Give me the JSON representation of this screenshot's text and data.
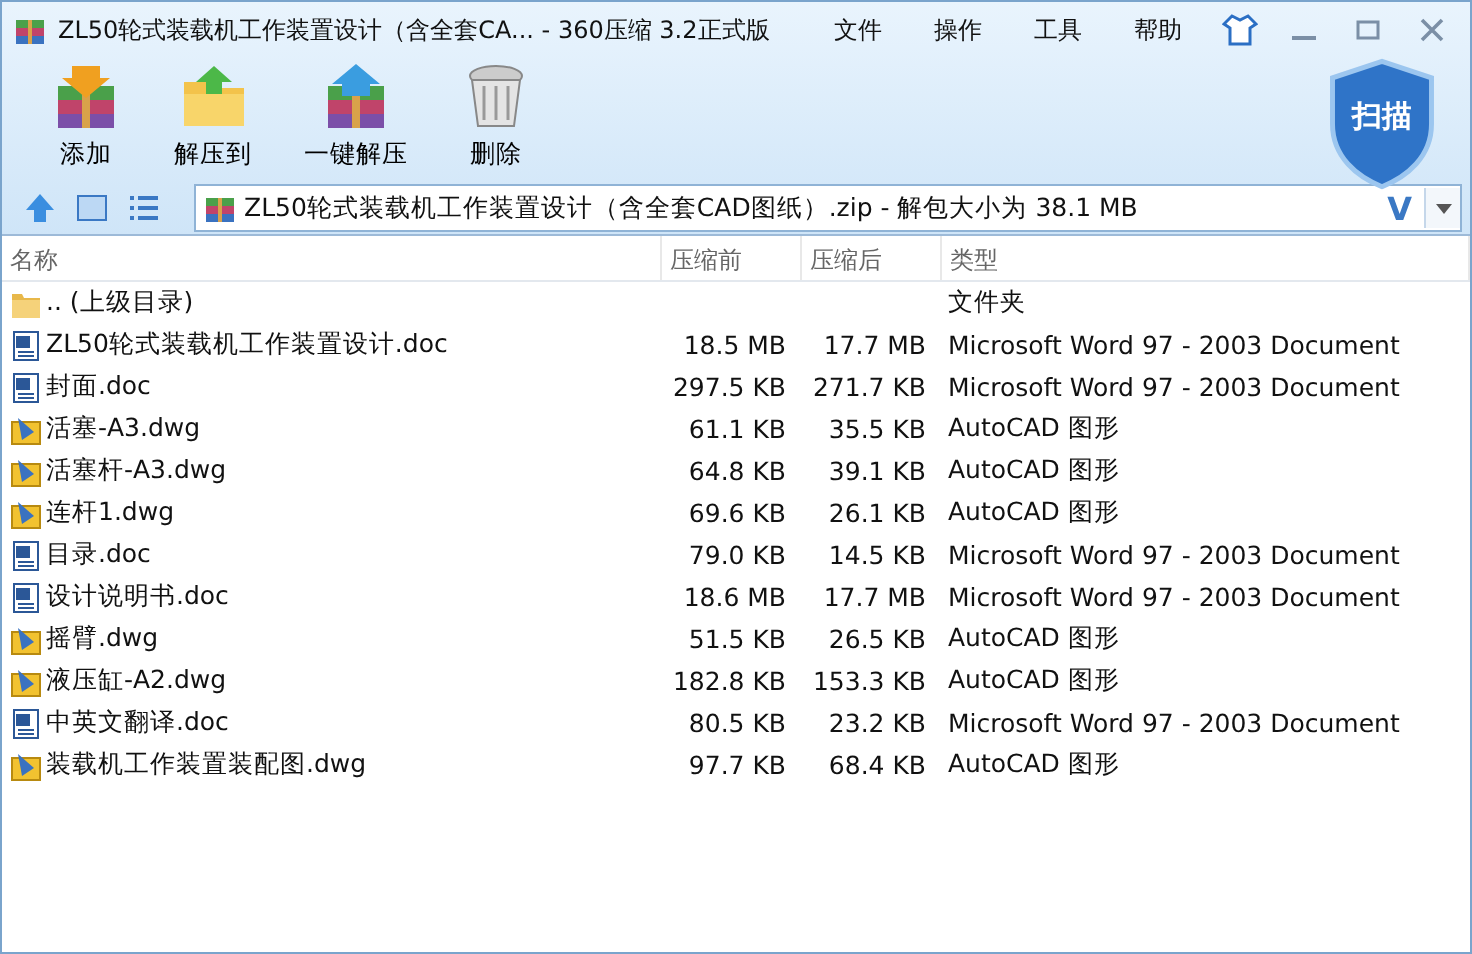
{
  "window": {
    "title": "ZL50轮式装载机工作装置设计（含全套CA... - 360压缩 3.2正式版"
  },
  "menu": [
    "文件",
    "操作",
    "工具",
    "帮助"
  ],
  "toolbar": [
    {
      "label": "添加",
      "kind": "add"
    },
    {
      "label": "解压到",
      "kind": "extract"
    },
    {
      "label": "一键解压",
      "kind": "oneclick"
    },
    {
      "label": "删除",
      "kind": "delete"
    }
  ],
  "scan_button": {
    "label": "扫描"
  },
  "address": {
    "value": "ZL50轮式装载机工作装置设计（含全套CAD图纸）.zip - 解包大小为 38.1 MB",
    "dropdown_letter": "V"
  },
  "table": {
    "columns": [
      "名称",
      "压缩前",
      "压缩后",
      "类型"
    ],
    "rows": [
      {
        "kind": "folder",
        "name": ".. (上级目录)",
        "before": "",
        "after": "",
        "type": "文件夹"
      },
      {
        "kind": "doc",
        "name": "ZL50轮式装载机工作装置设计.doc",
        "before": "18.5 MB",
        "after": "17.7 MB",
        "type": "Microsoft Word 97 - 2003 Document"
      },
      {
        "kind": "doc",
        "name": "封面.doc",
        "before": "297.5 KB",
        "after": "271.7 KB",
        "type": "Microsoft Word 97 - 2003 Document"
      },
      {
        "kind": "dwg",
        "name": "活塞-A3.dwg",
        "before": "61.1 KB",
        "after": "35.5 KB",
        "type": "AutoCAD 图形"
      },
      {
        "kind": "dwg",
        "name": "活塞杆-A3.dwg",
        "before": "64.8 KB",
        "after": "39.1 KB",
        "type": "AutoCAD 图形"
      },
      {
        "kind": "dwg",
        "name": "连杆1.dwg",
        "before": "69.6 KB",
        "after": "26.1 KB",
        "type": "AutoCAD 图形"
      },
      {
        "kind": "doc",
        "name": "目录.doc",
        "before": "79.0 KB",
        "after": "14.5 KB",
        "type": "Microsoft Word 97 - 2003 Document"
      },
      {
        "kind": "doc",
        "name": "设计说明书.doc",
        "before": "18.6 MB",
        "after": "17.7 MB",
        "type": "Microsoft Word 97 - 2003 Document"
      },
      {
        "kind": "dwg",
        "name": "摇臂.dwg",
        "before": "51.5 KB",
        "after": "26.5 KB",
        "type": "AutoCAD 图形"
      },
      {
        "kind": "dwg",
        "name": "液压缸-A2.dwg",
        "before": "182.8 KB",
        "after": "153.3 KB",
        "type": "AutoCAD 图形"
      },
      {
        "kind": "doc",
        "name": "中英文翻译.doc",
        "before": "80.5 KB",
        "after": "23.2 KB",
        "type": "Microsoft Word 97 - 2003 Document"
      },
      {
        "kind": "dwg",
        "name": "装载机工作装置装配图.dwg",
        "before": "97.7 KB",
        "after": "68.4 KB",
        "type": "AutoCAD 图形"
      }
    ]
  }
}
